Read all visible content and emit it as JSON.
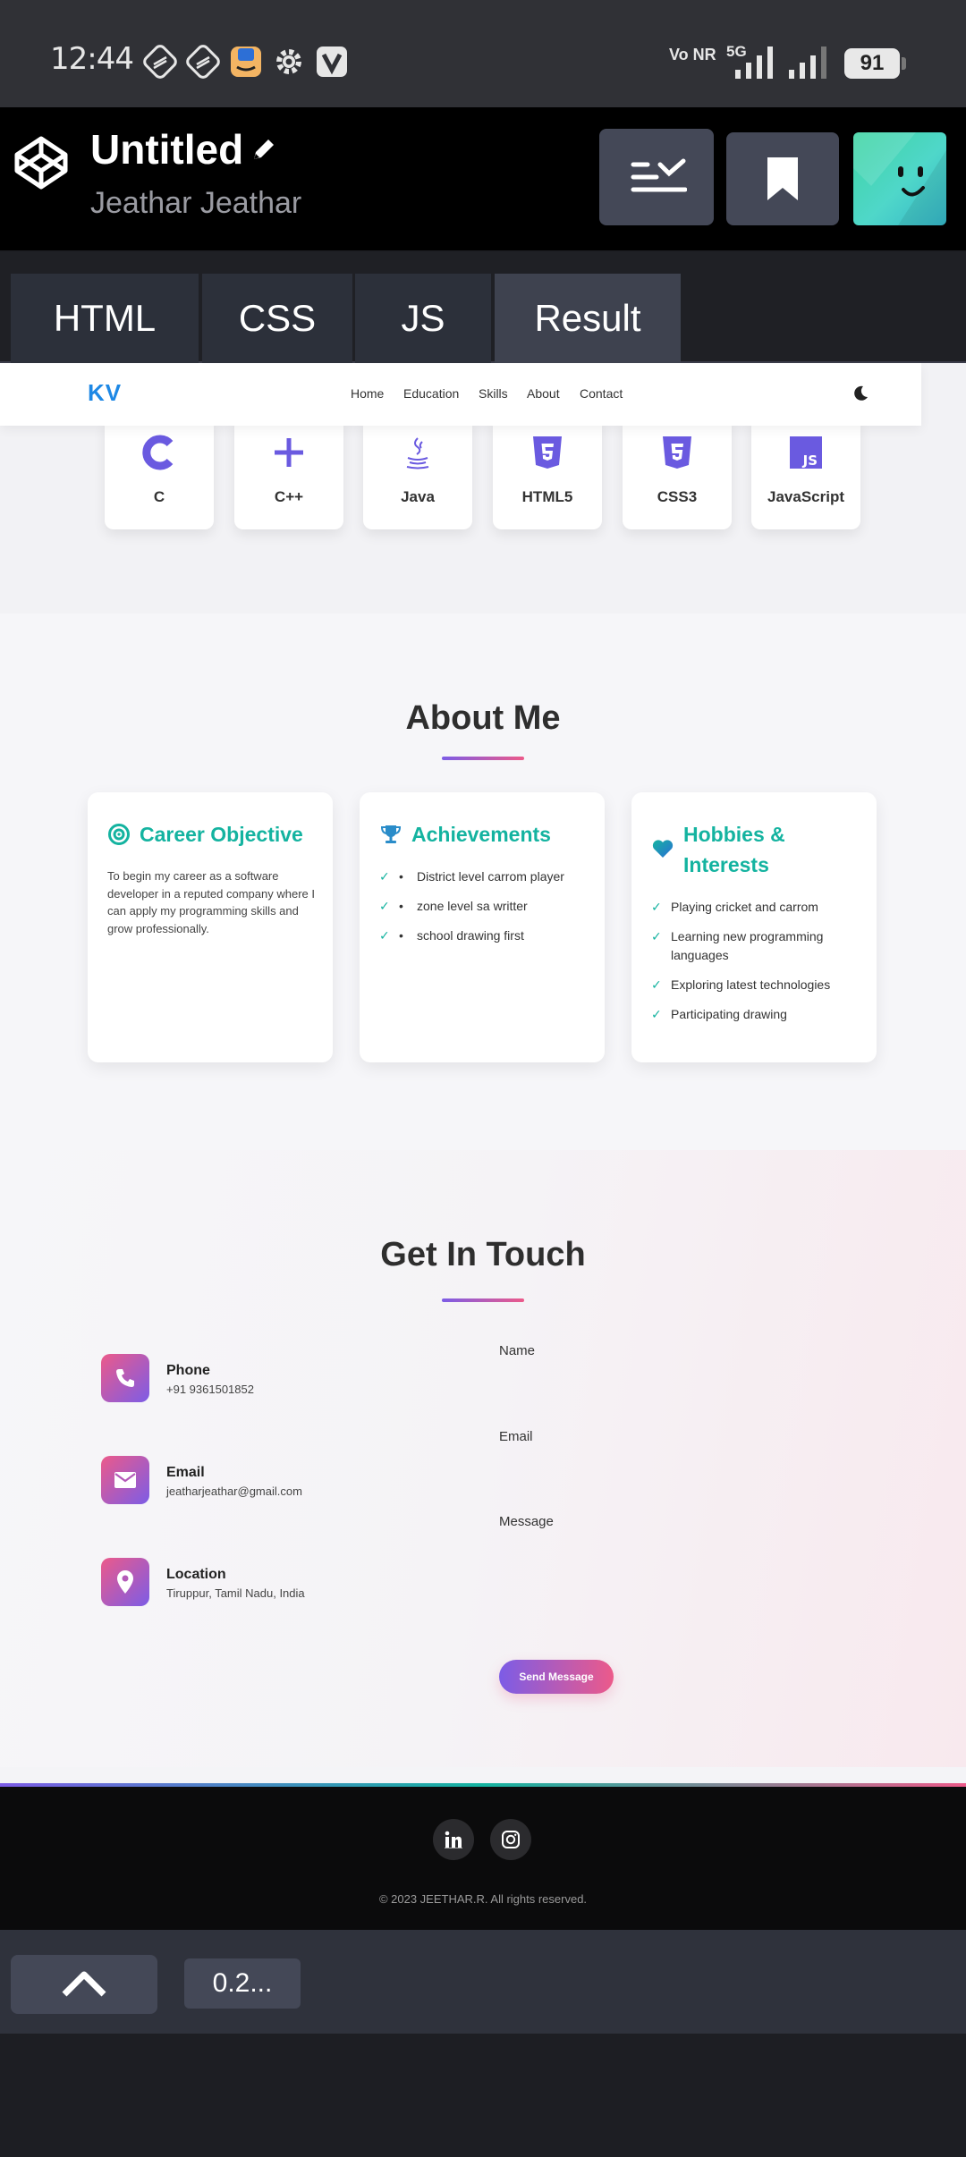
{
  "status_bar": {
    "time": "12:44",
    "network": "5G",
    "volte": "Vo NR",
    "battery": "91",
    "icons": [
      "app-icon-1",
      "app-icon-2",
      "amazon-icon",
      "settings-icon",
      "v-app-icon"
    ]
  },
  "codepen": {
    "title": "Untitled",
    "author": "Jeathar Jeathar",
    "tabs": [
      "HTML",
      "CSS",
      "JS",
      "Result"
    ],
    "active_tab": "Result",
    "zoom": "0.2..."
  },
  "site": {
    "brand": "KV",
    "nav": [
      "Home",
      "Education",
      "Skills",
      "About",
      "Contact"
    ],
    "skills": [
      "C",
      "C++",
      "Java",
      "HTML5",
      "CSS3",
      "JavaScript"
    ],
    "about": {
      "title": "About Me",
      "career": {
        "title": "Career Objective",
        "text": "To begin my career as a software developer in a reputed company where I can apply my programming skills and grow professionally."
      },
      "achievements": {
        "title": "Achievements",
        "items": [
          "District level carrom player",
          "zone level sa writter",
          "school drawing first"
        ]
      },
      "hobbies": {
        "title_line1": "Hobbies &",
        "title_line2": "Interests",
        "items": [
          "Playing cricket and carrom",
          "Learning new programming languages",
          "Exploring latest technologies",
          "Participating drawing"
        ]
      }
    },
    "contact": {
      "title": "Get In Touch",
      "phone_label": "Phone",
      "phone": "+91 9361501852",
      "email_label": "Email",
      "email": "jeatharjeathar@gmail.com",
      "location_label": "Location",
      "location": "Tiruppur, Tamil Nadu, India",
      "form": {
        "name": "Name",
        "email": "Email",
        "message": "Message",
        "send": "Send Message"
      }
    },
    "footer": {
      "copyright": "© 2023 JEETHAR.R. All rights reserved."
    }
  },
  "colors": {
    "accent_teal": "#14b3a0",
    "accent_purple": "#7c5ce6",
    "accent_pink": "#ec5a8a",
    "brand_blue": "#1e88e5"
  }
}
